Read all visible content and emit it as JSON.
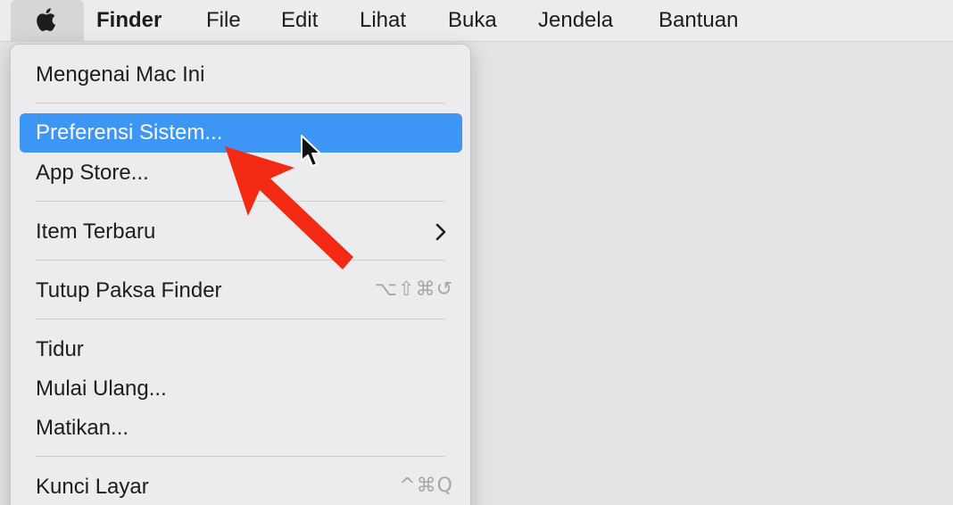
{
  "menubar": {
    "apple_icon": "apple-logo-icon",
    "app_name": "Finder",
    "menus": [
      "File",
      "Edit",
      "Lihat",
      "Buka",
      "Jendela",
      "Bantuan"
    ]
  },
  "apple_menu": {
    "items": [
      {
        "label": "Mengenai Mac Ini",
        "shortcut": ""
      },
      {
        "label": "Preferensi Sistem...",
        "shortcut": "",
        "highlighted": true
      },
      {
        "label": "App Store...",
        "shortcut": ""
      },
      {
        "label": "Item Terbaru",
        "shortcut": "",
        "submenu_icon": "chevron-right-icon"
      },
      {
        "label": "Tutup Paksa Finder",
        "shortcut": "⌥⇧⌘↺"
      },
      {
        "label": "Tidur",
        "shortcut": ""
      },
      {
        "label": "Mulai Ulang...",
        "shortcut": ""
      },
      {
        "label": "Matikan...",
        "shortcut": ""
      },
      {
        "label": "Kunci Layar",
        "shortcut": "^⌘Q"
      }
    ]
  },
  "colors": {
    "highlight": "#3d95f5",
    "annotation_arrow": "#f52a14",
    "menubar_bg": "#ececee"
  }
}
